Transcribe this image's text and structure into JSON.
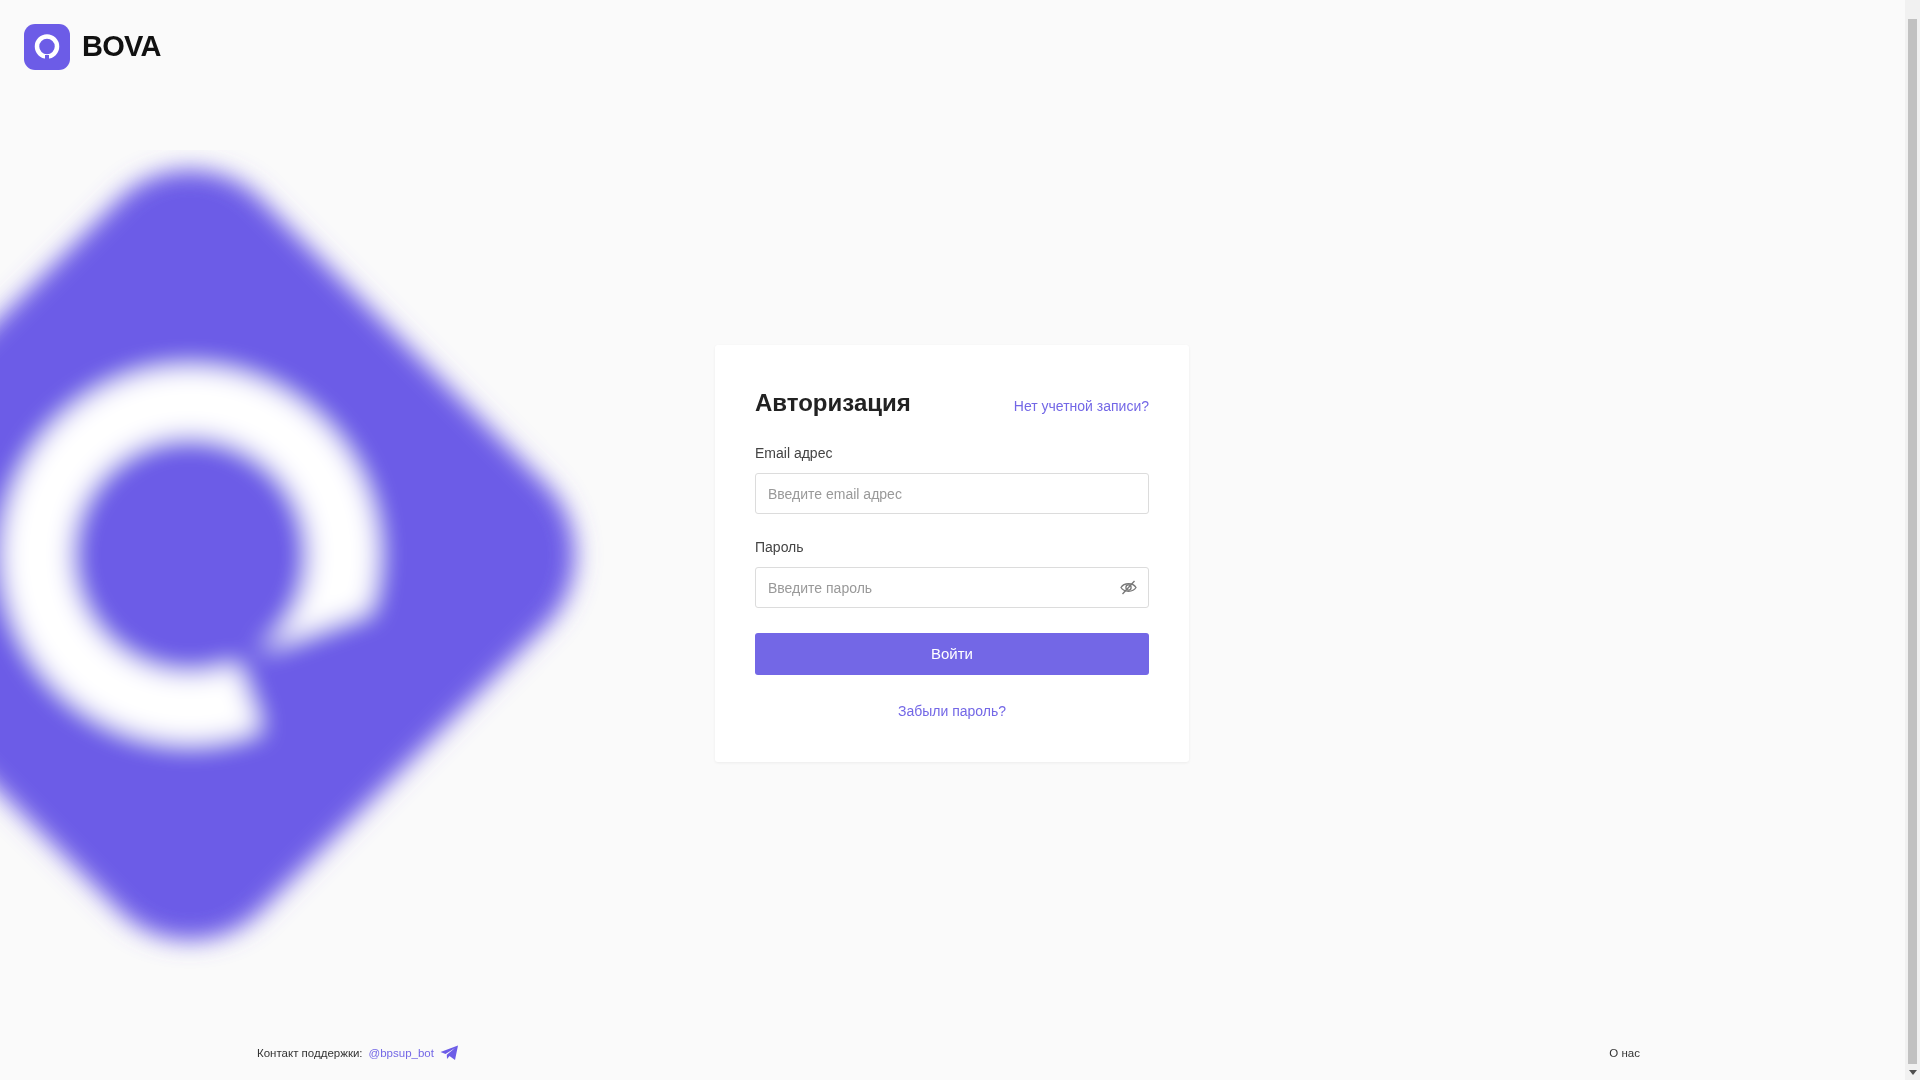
{
  "header": {
    "logo_text": "BOVA"
  },
  "login_card": {
    "title": "Авторизация",
    "signup_link": "Нет учетной записи?",
    "fields": [
      {
        "kind": "email",
        "label": "Email адрес",
        "placeholder": "Введите email адрес"
      },
      {
        "kind": "password",
        "label": "Пароль",
        "placeholder": "Введите пароль"
      }
    ],
    "submit_button": "Войти",
    "forgot_link": "Забыли пароль?"
  },
  "footer": {
    "support_label": "Контакт поддержки:",
    "support_link": "@bpsup_bot",
    "about_link": "О нас"
  }
}
